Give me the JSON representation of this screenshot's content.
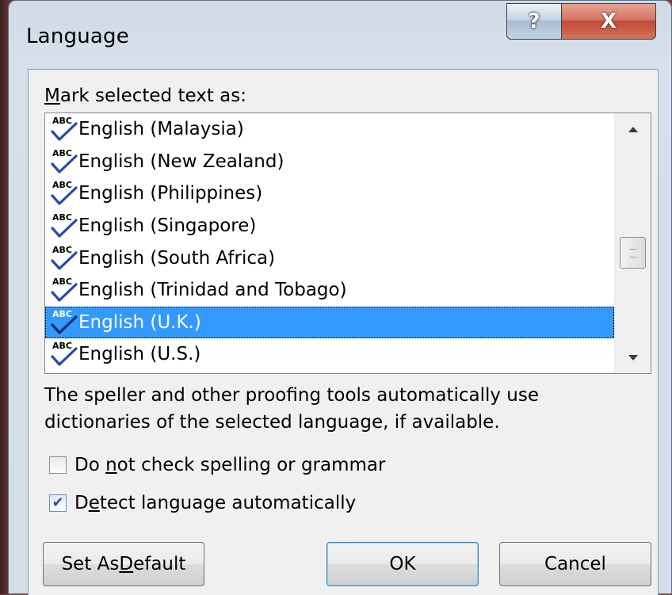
{
  "window": {
    "title": "Language",
    "help_glyph": "?",
    "close_glyph": "X"
  },
  "label": {
    "prefix": "M",
    "rest": "ark selected text as:"
  },
  "languages": [
    {
      "name": "English (Malaysia)",
      "selected": false
    },
    {
      "name": "English (New Zealand)",
      "selected": false
    },
    {
      "name": "English (Philippines)",
      "selected": false
    },
    {
      "name": "English (Singapore)",
      "selected": false
    },
    {
      "name": "English (South Africa)",
      "selected": false
    },
    {
      "name": "English (Trinidad and Tobago)",
      "selected": false
    },
    {
      "name": "English (U.K.)",
      "selected": true
    },
    {
      "name": "English (U.S.)",
      "selected": false
    }
  ],
  "spell_icon_text": "ABC",
  "description": {
    "line1": "The speller and other proofing tools automatically use",
    "line2": "dictionaries of the selected language, if available."
  },
  "options": {
    "no_check": {
      "pre": "Do ",
      "key": "n",
      "post": "ot check spelling or grammar",
      "checked": false
    },
    "detect": {
      "pre": "D",
      "key": "e",
      "post": "tect language automatically",
      "checked": true
    }
  },
  "buttons": {
    "set_default": {
      "pre": "Set As ",
      "key": "D",
      "post": "efault"
    },
    "ok": "OK",
    "cancel": "Cancel"
  },
  "colors": {
    "selection": "#3399ff",
    "close_button": "#c04b35",
    "check_mark": "#1f4ea8"
  }
}
